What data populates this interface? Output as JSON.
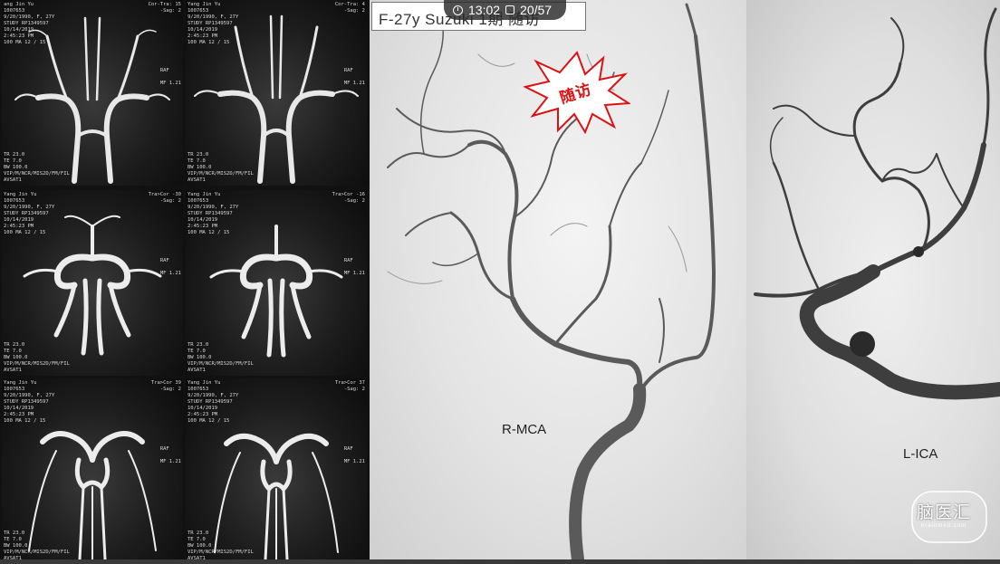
{
  "header": {
    "title": "F-27y Suzuki 1期 随访",
    "time": "13:02",
    "slide": "20/57"
  },
  "stamp": {
    "text": "随访",
    "color": "#dd1111"
  },
  "annotations": {
    "right": "R-MCA",
    "left": "L-ICA"
  },
  "logo": {
    "name": "脑医汇",
    "sub": "brainmed.com"
  },
  "film": {
    "cells": [
      {
        "tl": "ang Jin Yu\n1007653\n9/20/1990, F, 27Y\nSTUDY RP1349597\n10/14/2019\n2:45:23 PM\n100 MA 12 / 15",
        "tr": "Cor-Tra: 15\n-Sag: 2",
        "bl": "TR 23.0\nTE 7.0\nBW 100.0\nVIP/M/NCR/MIS2D/FM/FIL\nAVSAT1",
        "mid": "RAF\n\nMF 1.21"
      },
      {
        "tl": "Yang Jin Yu\n1007653\n9/20/1990, F, 27Y\nSTUDY RP1349597\n10/14/2019\n2:45:23 PM\n100 MA 12 / 15",
        "tr": "Cor-Tra: 4\n-Sag: 2",
        "bl": "TR 23.0\nTE 7.0\nBW 100.0\nVIP/M/NCR/MIS2D/FM/FIL\nAVSAT1",
        "mid": "RAF\n\nMF 1.21"
      },
      {
        "tl": "Yang Jin Yu\n1007653\n9/20/1990, F, 27Y\nSTUDY RP1349597\n10/14/2019\n2:45:23 PM\n100 MA 12 / 15",
        "tr": "Tra>Cor -30\n-Sag: 2",
        "bl": "TR 23.0\nTE 7.0\nBW 100.0\nVIP/M/NCR/MIS2D/FM/FIL\nAVSAT1",
        "mid": "RAF\n\nMF 1.21"
      },
      {
        "tl": "Yang Jin Yu\n1007653\n9/20/1990, F, 27Y\nSTUDY RP1349597\n10/14/2019\n2:45:23 PM\n100 MA 12 / 15",
        "tr": "Tra>Cor -16\n-Sag: 2",
        "bl": "TR 23.0\nTE 7.0\nBW 100.0\nVIP/M/NCR/MIS2D/FM/FIL\nAVSAT1",
        "mid": "RAF\n\nMF 1.21"
      },
      {
        "tl": "Yang Jin Yu\n1007653\n9/20/1990, F, 27Y\nSTUDY RP1349597\n10/14/2019\n2:45:23 PM\n100 MA 12 / 15",
        "tr": "Tra>Cor 39\n-Sag: 2",
        "bl": "TR 23.0\nTE 7.0\nBW 100.0\nVIP/M/NCR/MIS2D/FM/FIL\nAVSAT1",
        "mid": "RAF\n\nMF 1.21"
      },
      {
        "tl": "Yang Jin Yu\n1007653\n9/20/1990, F, 27Y\nSTUDY RP1349597\n10/14/2019\n2:45:23 PM\n100 MA 12 / 15",
        "tr": "Tra>Cor 37\n-Sag: 2",
        "bl": "TR 23.0\nTE 7.0\nBW 100.0\nVIP/M/NCR/MIS2D/FM/FIL\nAVSAT1",
        "mid": "RAF\n\nMF 1.21"
      }
    ]
  }
}
